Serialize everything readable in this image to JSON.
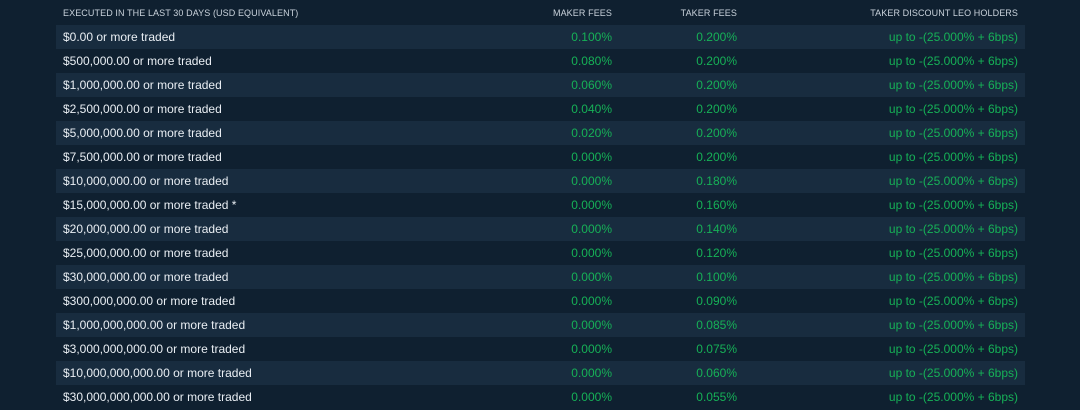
{
  "table": {
    "headers": {
      "tier": "EXECUTED IN THE LAST 30 DAYS (USD EQUIVALENT)",
      "maker": "MAKER FEES",
      "taker": "TAKER FEES",
      "discount": "TAKER DISCOUNT LEO HOLDERS"
    },
    "rows": [
      {
        "tier": "$0.00 or more traded",
        "maker": "0.100%",
        "taker": "0.200%",
        "discount": "up to -(25.000% + 6bps)"
      },
      {
        "tier": "$500,000.00 or more traded",
        "maker": "0.080%",
        "taker": "0.200%",
        "discount": "up to -(25.000% + 6bps)"
      },
      {
        "tier": "$1,000,000.00 or more traded",
        "maker": "0.060%",
        "taker": "0.200%",
        "discount": "up to -(25.000% + 6bps)"
      },
      {
        "tier": "$2,500,000.00 or more traded",
        "maker": "0.040%",
        "taker": "0.200%",
        "discount": "up to -(25.000% + 6bps)"
      },
      {
        "tier": "$5,000,000.00 or more traded",
        "maker": "0.020%",
        "taker": "0.200%",
        "discount": "up to -(25.000% + 6bps)"
      },
      {
        "tier": "$7,500,000.00 or more traded",
        "maker": "0.000%",
        "taker": "0.200%",
        "discount": "up to -(25.000% + 6bps)"
      },
      {
        "tier": "$10,000,000.00 or more traded",
        "maker": "0.000%",
        "taker": "0.180%",
        "discount": "up to -(25.000% + 6bps)"
      },
      {
        "tier": "$15,000,000.00 or more traded *",
        "maker": "0.000%",
        "taker": "0.160%",
        "discount": "up to -(25.000% + 6bps)"
      },
      {
        "tier": "$20,000,000.00 or more traded",
        "maker": "0.000%",
        "taker": "0.140%",
        "discount": "up to -(25.000% + 6bps)"
      },
      {
        "tier": "$25,000,000.00 or more traded",
        "maker": "0.000%",
        "taker": "0.120%",
        "discount": "up to -(25.000% + 6bps)"
      },
      {
        "tier": "$30,000,000.00 or more traded",
        "maker": "0.000%",
        "taker": "0.100%",
        "discount": "up to -(25.000% + 6bps)"
      },
      {
        "tier": "$300,000,000.00 or more traded",
        "maker": "0.000%",
        "taker": "0.090%",
        "discount": "up to -(25.000% + 6bps)"
      },
      {
        "tier": "$1,000,000,000.00 or more traded",
        "maker": "0.000%",
        "taker": "0.085%",
        "discount": "up to -(25.000% + 6bps)"
      },
      {
        "tier": "$3,000,000,000.00 or more traded",
        "maker": "0.000%",
        "taker": "0.075%",
        "discount": "up to -(25.000% + 6bps)"
      },
      {
        "tier": "$10,000,000,000.00 or more traded",
        "maker": "0.000%",
        "taker": "0.060%",
        "discount": "up to -(25.000% + 6bps)"
      },
      {
        "tier": "$30,000,000,000.00 or more traded",
        "maker": "0.000%",
        "taker": "0.055%",
        "discount": "up to -(25.000% + 6bps)"
      }
    ]
  },
  "colors": {
    "background": "#0f2030",
    "row_stripe": "#182c3f",
    "fee_green": "#16b157",
    "text_light": "#e9eef3",
    "header_text": "#c9d2db"
  }
}
